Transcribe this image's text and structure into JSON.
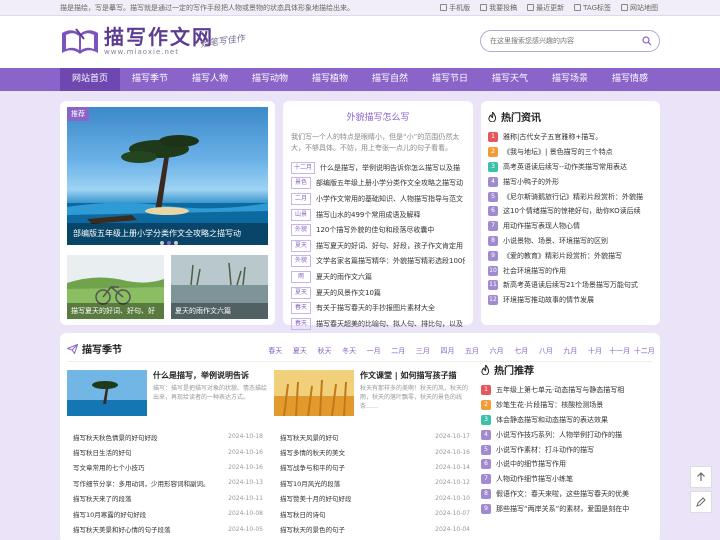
{
  "topbar": {
    "text": "描是描绘，写是摹写。描写就是通过一定的写作手段把人物或景物的状态具体形象地描绘出来。",
    "links": [
      "手机版",
      "我要投稿",
      "最近更新",
      "TAG标签",
      "网站地图"
    ]
  },
  "header": {
    "logo_title": "描写作文网",
    "logo_url": "www.miaoxie.net",
    "slogan": "妙笔写佳作",
    "search_placeholder": "在这里搜索您感兴趣的内容"
  },
  "nav": [
    "网站首页",
    "描写季节",
    "描写人物",
    "描写动物",
    "描写植物",
    "描写自然",
    "描写节日",
    "描写天气",
    "描写场景",
    "描写情感"
  ],
  "slider": {
    "badge": "推荐",
    "main_caption": "部编版五年级上册小学分类作文全攻略之描写动",
    "sub": [
      "描写夏天的好词、好句、好",
      "夏天的雨作文六篇"
    ]
  },
  "center": {
    "title": "外貌描写怎么写",
    "intro": "我们写一个人的特点是眼睛小，但是“小”的范围仍然太大，不够具体。不妨，用上夸张一点儿的句子看看。",
    "rows": [
      {
        "tag": "十二月",
        "text": "什么是描写，举例说明告诉你怎么描写以及描"
      },
      {
        "tag": "景色",
        "text": "部编版五年级上册小学分类作文全攻略之描写动"
      },
      {
        "tag": "二月",
        "text": "小学作文常用的基础知识、人物描写指导与范文"
      },
      {
        "tag": "山景",
        "text": "描写山水的499个常用成语及解释"
      },
      {
        "tag": "外貌",
        "text": "120个描写外貌的佳句和段落尽收囊中"
      },
      {
        "tag": "夏天",
        "text": "描写夏天的好词、好句、好段，孩子作文肯定用"
      },
      {
        "tag": "外貌",
        "text": "文学名家名篇描写精华：外貌描写精彩选段100例"
      },
      {
        "tag": "雨",
        "text": "夏天的雨作文六篇"
      },
      {
        "tag": "夏天",
        "text": "夏天的风景作文10篇"
      },
      {
        "tag": "春天",
        "text": "有关于描写春天的手抄报图片素材大全"
      },
      {
        "tag": "春天",
        "text": "描写春天超美的比喻句、拟人句、排比句，以及"
      }
    ]
  },
  "hot": {
    "title": "热门资讯",
    "items": [
      "雅称|古代女子五官雅称+描写。",
      "《我与地坛》| 景色描写的三个特点",
      "高考英语读后续写--动作类描写常用表达",
      "描写小鸭子的外形",
      "《尼尔斯骑鹅旅行记》精彩片段赏析：外貌描",
      "这10个情绪描写的惊艳好句，助你KO读后续",
      "用动作描写表现人物心情",
      "小说景物、场景、环境描写的区别",
      "《爱的教育》精彩片段赏析：外貌描写",
      "社会环境描写的作用",
      "新高考英语读后续写21个场景描写万能句式",
      "环境描写推动故事的情节发展"
    ]
  },
  "season": {
    "title": "描写季节",
    "tabs": [
      "春天",
      "夏天",
      "秋天",
      "冬天",
      "一月",
      "二月",
      "三月",
      "四月",
      "五月",
      "六月",
      "七月",
      "八月",
      "九月",
      "十月",
      "十一月",
      "十二月"
    ],
    "features": [
      {
        "title": "什么是描写，举例说明告诉",
        "desc": "描写：描写是把描写对象的状貌、情态描绘出来，再现给读者的一种表达方式。"
      },
      {
        "title": "作文课堂 | 如何描写孩子描",
        "desc": "秋天有那样多的美啊！秋天的风，秋天的雨，秋天的落叶飘零，秋天的景色的线条……"
      }
    ],
    "list_left": [
      {
        "t": "描写秋天秋色情景的好句好段",
        "d": "2024-10-18"
      },
      {
        "t": "描写秋日生活的好句",
        "d": "2024-10-16"
      },
      {
        "t": "写文章常用的七个小技巧",
        "d": "2024-10-16"
      },
      {
        "t": "写作细节分享：多用动词，少用形容词和副词。",
        "d": "2024-10-13"
      },
      {
        "t": "描写秋天来了的段落",
        "d": "2024-10-11"
      },
      {
        "t": "描写10月寒露的好句好段",
        "d": "2024-10-08"
      },
      {
        "t": "描写秋天美景和好心情的句子段落",
        "d": "2024-10-05"
      }
    ],
    "list_right": [
      {
        "t": "描写秋天风景的好句",
        "d": "2024-10-17"
      },
      {
        "t": "描写多情的秋天的美文",
        "d": "2024-10-16"
      },
      {
        "t": "描写战争与和平的句子",
        "d": "2024-10-14"
      },
      {
        "t": "描写10月风光的段落",
        "d": "2024-10-12"
      },
      {
        "t": "描写赞美十月的好句好段",
        "d": "2024-10-10"
      },
      {
        "t": "描写秋日的诗句",
        "d": "2024-10-07"
      },
      {
        "t": "描写秋天的景色的句子",
        "d": "2024-10-04"
      }
    ]
  },
  "recommend": {
    "title": "热门推荐",
    "items": [
      "五年级上第七单元·动态描写与静态描写相",
      "妙笔生花·片段描写：核酸检测场景",
      "体会静态描写和动态描写的表达效果",
      "小说写作技巧系列：人物举例打动作的描",
      "小说写作素材：打斗动作的描写",
      "小说中的细节描写作用",
      "人物动作细节描写小练笔",
      "假语作文：春天来啦，这些描写春天的优美",
      "那些描写“两岸关系”的素材，爱国是刻在中"
    ]
  },
  "colors": {
    "accent": "#8a64c8",
    "nav_active": "#6f47b0",
    "background": "#ebe4f8"
  }
}
